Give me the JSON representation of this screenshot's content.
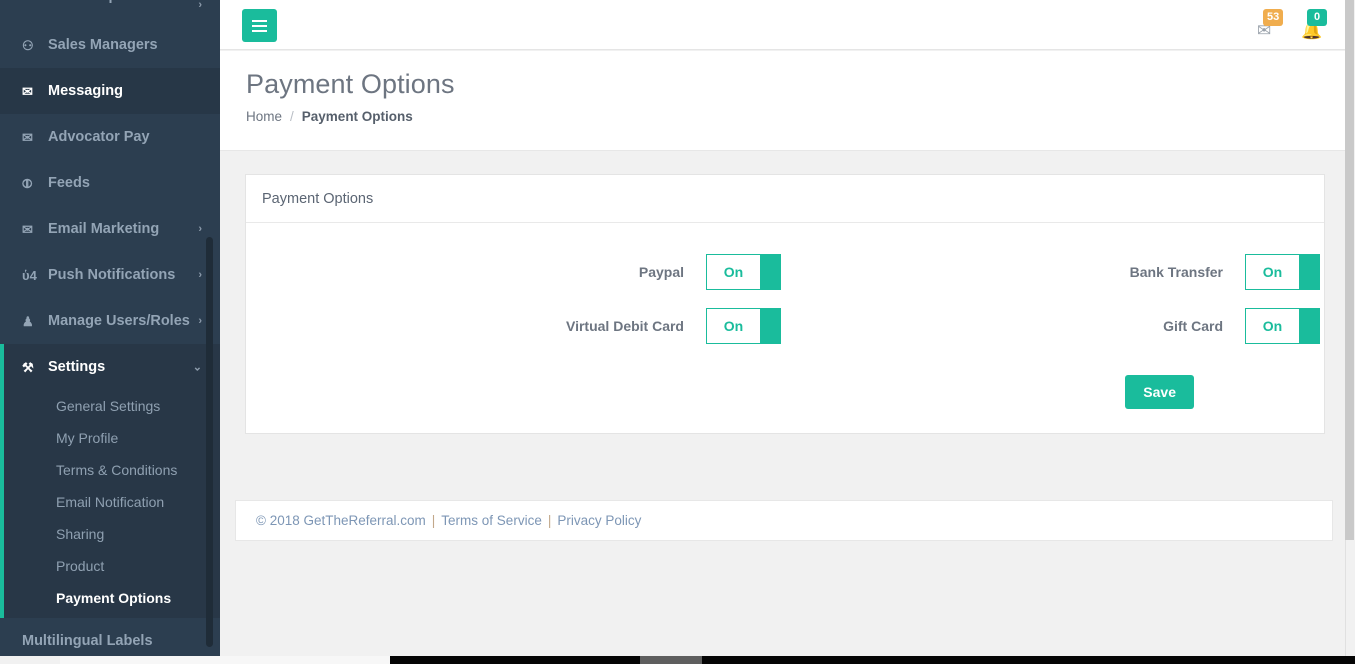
{
  "sidebar": {
    "items": [
      {
        "label": "Sales Reps",
        "icon": "chart-bar-icon",
        "glyph": "☷",
        "caret": "›",
        "active": false,
        "clipped": true
      },
      {
        "label": "Sales Managers",
        "icon": "users-group-icon",
        "glyph": "⚇",
        "caret": "",
        "active": false
      },
      {
        "label": "Messaging",
        "icon": "envelope-icon",
        "glyph": "✉",
        "caret": "",
        "active": true
      },
      {
        "label": "Advocator Pay",
        "icon": "envelope-icon",
        "glyph": "✉",
        "caret": "",
        "active": false
      },
      {
        "label": "Feeds",
        "icon": "rss-icon",
        "glyph": "⦷",
        "caret": "",
        "active": false
      },
      {
        "label": "Email Marketing",
        "icon": "envelope-icon",
        "glyph": "✉",
        "caret": "›",
        "active": false
      },
      {
        "label": "Push Notifications",
        "icon": "bell-icon",
        "glyph": "ὑ4",
        "caret": "›",
        "active": false
      },
      {
        "label": "Manage Users/Roles",
        "icon": "user-icon",
        "glyph": "♟",
        "caret": "›",
        "active": false
      }
    ],
    "settings_group": {
      "label": "Settings",
      "icon": "wrench-icon",
      "glyph": "⚒",
      "caret": "⌄",
      "sub_items": [
        {
          "label": "General Settings",
          "current": false
        },
        {
          "label": "My Profile",
          "current": false
        },
        {
          "label": "Terms & Conditions",
          "current": false
        },
        {
          "label": "Email Notification",
          "current": false
        },
        {
          "label": "Sharing",
          "current": false
        },
        {
          "label": "Product",
          "current": false
        },
        {
          "label": "Payment Options",
          "current": true
        }
      ]
    },
    "tail_items": [
      {
        "label": "Multilingual Labels",
        "icon": "",
        "glyph": "",
        "caret": ""
      }
    ],
    "accent_color": "#1abc9c",
    "background_color": "#2c3e50"
  },
  "topbar": {
    "menu_toggle_label": "Toggle navigation",
    "messages": {
      "icon": "envelope-icon",
      "glyph": "✉",
      "count": "53",
      "color": "#f0ad4e"
    },
    "alerts": {
      "icon": "bell-icon",
      "glyph": "ὑ4",
      "count": "0",
      "color": "#1abc9c"
    }
  },
  "page": {
    "title": "Payment Options",
    "breadcrumb": {
      "home": "Home",
      "separator": "/",
      "current": "Payment Options"
    }
  },
  "panel": {
    "heading": "Payment Options",
    "fields": [
      {
        "label": "Paypal",
        "value": "On",
        "state": true
      },
      {
        "label": "Bank Transfer",
        "value": "On",
        "state": true
      },
      {
        "label": "Virtual Debit Card",
        "value": "On",
        "state": true
      },
      {
        "label": "Gift Card",
        "value": "On",
        "state": true
      }
    ],
    "save_label": "Save"
  },
  "footer": {
    "copyright": "© 2018 GetTheReferral.com",
    "sep1": "|",
    "terms": "Terms of Service",
    "sep2": "|",
    "privacy": "Privacy Policy"
  }
}
